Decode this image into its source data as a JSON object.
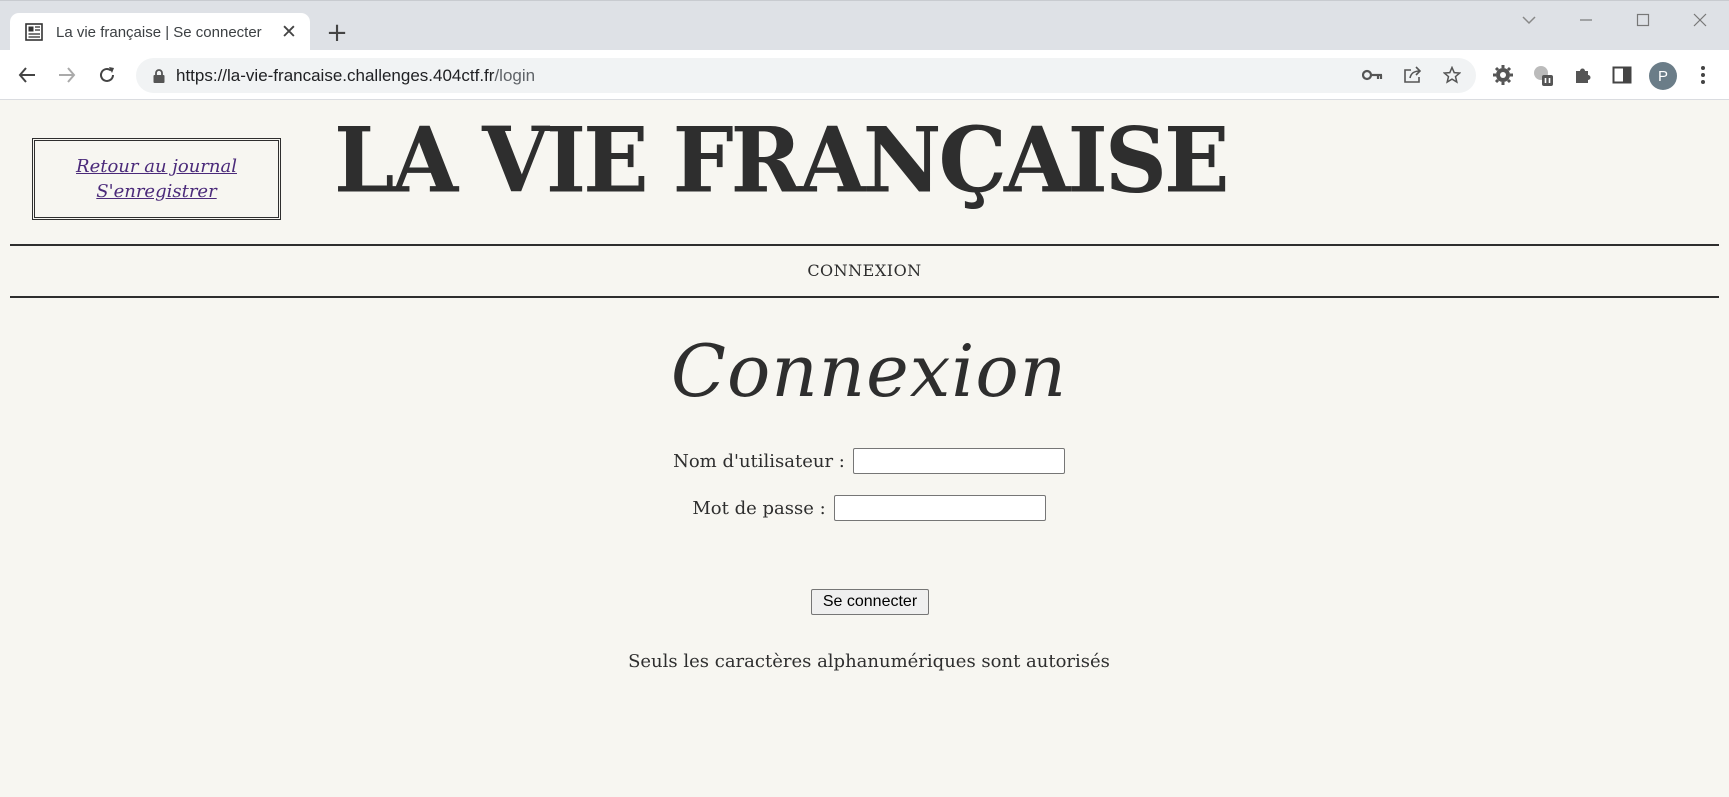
{
  "browser": {
    "tab": {
      "title": "La vie française | Se connecter",
      "favicon": "newspaper-icon",
      "close_icon": "close-icon"
    },
    "new_tab_icon": "plus-icon",
    "window_controls": [
      "chevron-down-icon",
      "minimize-icon",
      "maximize-icon",
      "close-icon"
    ],
    "nav": {
      "back_icon": "back-arrow-icon",
      "forward_icon": "forward-arrow-icon",
      "reload_icon": "reload-icon"
    },
    "address_bar": {
      "host": "https://la-vie-francaise.challenges.404ctf.fr",
      "path": "/login",
      "lock_icon": "lock-icon",
      "right_icons": [
        "key-icon",
        "share-icon",
        "star-icon"
      ]
    },
    "extensions": [
      "gear-extension-icon",
      "paused-extension-icon",
      "puzzle-icon",
      "side-panel-icon"
    ],
    "profile_initial": "P",
    "menu_icon": "kebab-menu-icon"
  },
  "page": {
    "side_links": {
      "back_to_journal": "Retour au journal",
      "register": "S'enregistrer"
    },
    "masthead": "LA VIE FRANÇAISE",
    "nav_label": "CONNEXION",
    "heading": "Connexion",
    "form": {
      "username_label": "Nom d'utilisateur :",
      "username_value": "",
      "password_label": "Mot de passe :",
      "password_value": "",
      "submit_label": "Se connecter"
    },
    "note": "Seuls les caractères alphanumériques sont autorisés"
  },
  "colors": {
    "page_background": "#f7f6f1",
    "text": "#2e2e2e",
    "visited_link": "#4b2a7a",
    "tabstrip": "#dee1e6",
    "avatar": "#6b7d88"
  }
}
